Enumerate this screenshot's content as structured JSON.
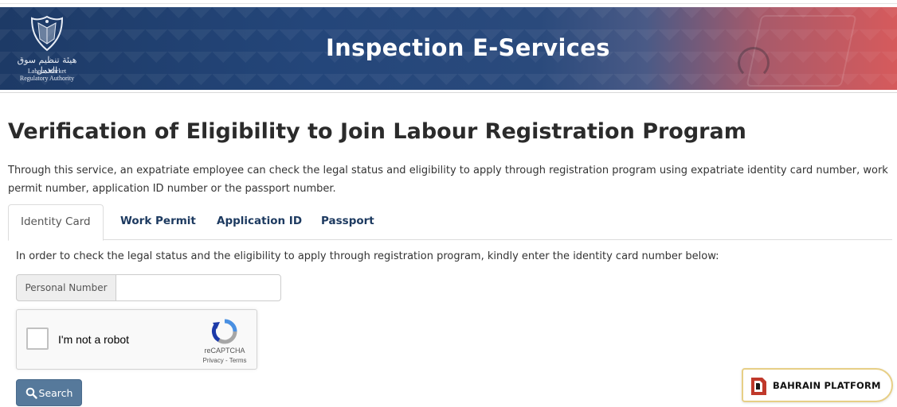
{
  "header": {
    "title": "Inspection E-Services",
    "logo": {
      "arabic_text": "هيئة تنظيم سوق العمل",
      "english_line1": "Labour Market",
      "english_line2": "Regulatory Authority"
    }
  },
  "main": {
    "title": "Verification of Eligibility to Join Labour Registration Program",
    "intro": "Through this service, an expatriate employee can check the legal status and eligibility to apply through registration program using expatriate identity card number, work permit number, application ID number or the passport number.",
    "tabs": [
      {
        "label": "Identity Card",
        "active": true
      },
      {
        "label": "Work Permit",
        "active": false
      },
      {
        "label": "Application ID",
        "active": false
      },
      {
        "label": "Passport",
        "active": false
      }
    ],
    "instruction": "In order to check the legal status and the eligibility to apply through registration program, kindly enter the identity card number below:",
    "personal_number": {
      "addon_label": "Personal Number",
      "value": "",
      "placeholder": ""
    },
    "recaptcha": {
      "label": "I'm not a robot",
      "brand": "reCAPTCHA",
      "links": "Privacy - Terms"
    },
    "search_button": {
      "label": "Search",
      "icon": "search-icon"
    }
  },
  "watermark": {
    "label": "BAHRAIN PLATFORM"
  },
  "colors": {
    "banner_dark": "#1d3a66",
    "banner_accent": "#d65a5c",
    "tab_text": "#1d3a60",
    "search_button": "#56799b",
    "badge_border": "#e7cf86"
  }
}
